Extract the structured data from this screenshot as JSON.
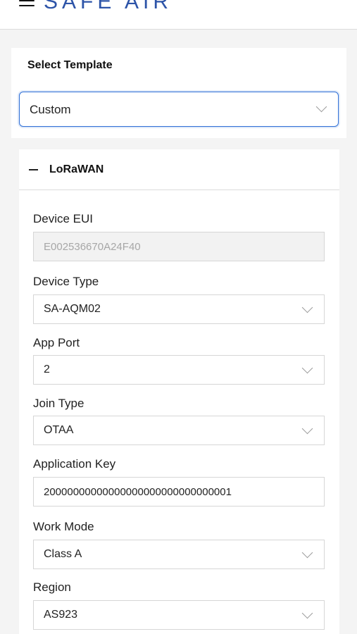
{
  "header": {
    "logo_text": "SAFE AIR",
    "menu_icon": "hamburger-menu-icon"
  },
  "template": {
    "label": "Select Template",
    "value": "Custom"
  },
  "section": {
    "title": "LoRaWAN",
    "toggle_icon": "minus-icon",
    "fields": {
      "device_eui": {
        "label": "Device EUI",
        "value": "E002536670A24F40"
      },
      "device_type": {
        "label": "Device Type",
        "value": "SA-AQM02"
      },
      "app_port": {
        "label": "App Port",
        "value": "2"
      },
      "join_type": {
        "label": "Join Type",
        "value": "OTAA"
      },
      "application_key": {
        "label": "Application Key",
        "value": "20000000000000000000000000000001"
      },
      "work_mode": {
        "label": "Work Mode",
        "value": "Class A"
      },
      "region": {
        "label": "Region",
        "value": "AS923"
      }
    }
  },
  "colors": {
    "accent": "#2f6fd6",
    "logo": "#2d54a8",
    "background": "#f4f4f4"
  }
}
